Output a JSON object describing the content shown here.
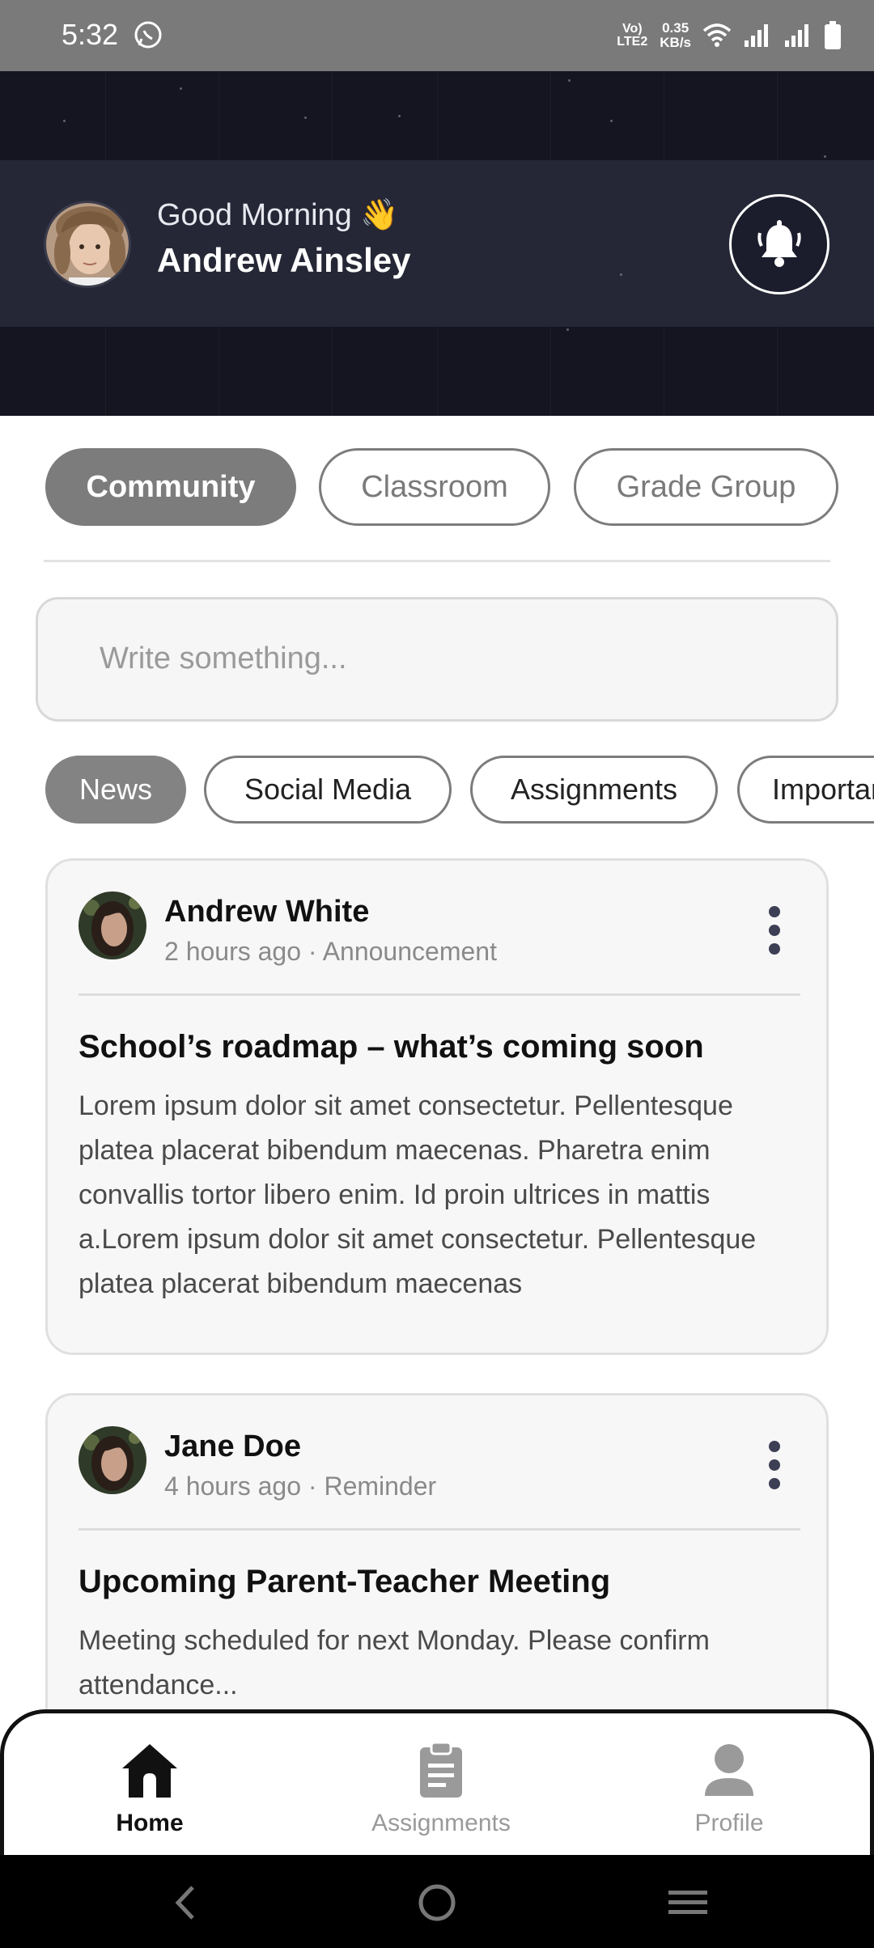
{
  "status_bar": {
    "time": "5:32",
    "network_type": "Vo) LTE2",
    "speed_value": "0.35",
    "speed_unit": "KB/s",
    "icons": [
      "whatsapp-icon",
      "wifi-icon",
      "signal-icon",
      "signal-icon",
      "battery-icon"
    ]
  },
  "header": {
    "greeting": "Good Morning 👋",
    "user_name": "Andrew Ainsley",
    "bell_icon": "bell-icon"
  },
  "main_tabs": [
    {
      "label": "Community",
      "active": true
    },
    {
      "label": "Classroom",
      "active": false
    },
    {
      "label": "Grade Group",
      "active": false
    }
  ],
  "composer": {
    "placeholder": "Write something..."
  },
  "filter_chips": [
    {
      "label": "News",
      "active": true
    },
    {
      "label": "Social Media",
      "active": false
    },
    {
      "label": "Assignments",
      "active": false
    },
    {
      "label": "Important",
      "active": false
    }
  ],
  "posts": [
    {
      "author": "Andrew White",
      "meta": "2 hours ago · Announcement",
      "title": "School’s roadmap – what’s coming soon",
      "body": "Lorem ipsum dolor sit amet consectetur. Pellentesque platea placerat bibendum maecenas. Pharetra enim convallis tortor libero enim. Id proin ultrices in mattis a.Lorem ipsum dolor sit amet consectetur. Pellentesque platea placerat bibendum maecenas"
    },
    {
      "author": "Jane Doe",
      "meta": "4 hours ago · Reminder",
      "title": "Upcoming Parent-Teacher Meeting",
      "body": "Meeting scheduled for next Monday. Please confirm attendance..."
    }
  ],
  "bottom_nav": [
    {
      "label": "Home",
      "icon": "home-icon",
      "active": true
    },
    {
      "label": "Assignments",
      "icon": "clipboard-icon",
      "active": false
    },
    {
      "label": "Profile",
      "icon": "profile-icon",
      "active": false
    }
  ],
  "colors": {
    "header_bg": "#151521",
    "header_band": "#262736",
    "active_tab": "#7c7c7c",
    "card_bg": "#f7f7f7"
  }
}
